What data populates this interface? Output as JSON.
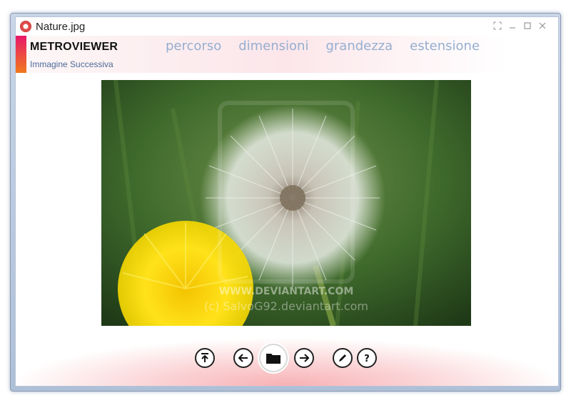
{
  "window": {
    "title": "Nature.jpg",
    "controls": [
      "fullscreen-icon",
      "minimize-icon",
      "maximize-icon",
      "close-icon"
    ]
  },
  "header": {
    "app_name": "METROVIEWER",
    "subtitle": "Immagine Successiva",
    "tabs": [
      "percorso",
      "dimensioni",
      "grandezza",
      "estensione"
    ]
  },
  "image": {
    "watermark_line1": "WWW.DEVIANTART.COM",
    "watermark_line2": "(c) SalvoG92.deviantart.com"
  },
  "toolbar": {
    "buttons": [
      "upload-icon",
      "previous-icon",
      "open-folder-icon",
      "next-icon",
      "edit-icon",
      "help-icon"
    ]
  },
  "colors": {
    "accent_top": "#e8186a",
    "accent_bottom": "#f07a1c",
    "tab_text": "#95aed0"
  }
}
